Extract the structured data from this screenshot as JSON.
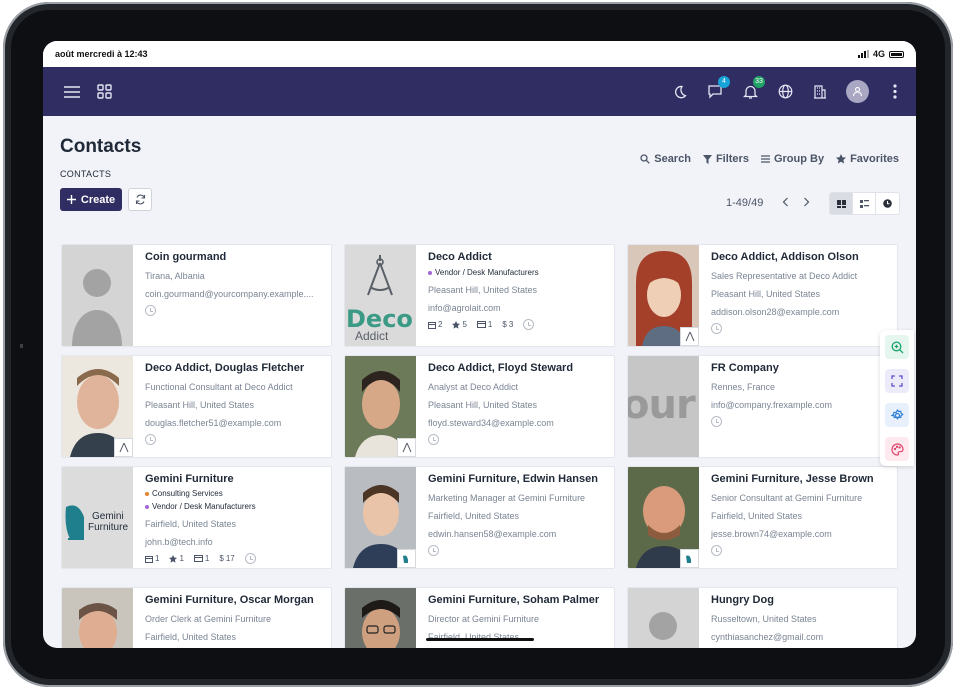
{
  "status_bar": {
    "datetime": "août mercredi à 12:43",
    "network": "4G"
  },
  "navbar": {
    "chat_badge": "4",
    "bell_badge": "33"
  },
  "page": {
    "title": "Contacts",
    "breadcrumb": "CONTACTS",
    "create_label": "Create"
  },
  "search_tools": [
    {
      "label": "Search",
      "icon": "search-icon"
    },
    {
      "label": "Filters",
      "icon": "filter-icon"
    },
    {
      "label": "Group By",
      "icon": "list-icon"
    },
    {
      "label": "Favorites",
      "icon": "star-icon"
    }
  ],
  "pager": {
    "range": "1-49/49"
  },
  "colors": {
    "navbar": "#2f2d62",
    "accent": "#2f2d62",
    "tag_orange": "#e0872e",
    "tag_purple": "#a366d6",
    "background": "#f2f3f8"
  },
  "cards": [
    {
      "name": "Coin gourmand",
      "lines": [
        "Tirana, Albania",
        "coin.gourmand@yourcompany.example...."
      ],
      "tags": [],
      "stats": null,
      "photo": "placeholder"
    },
    {
      "name": "Deco Addict",
      "tags": [
        {
          "label": "Vendor / Desk Manufacturers",
          "color": "purple"
        }
      ],
      "lines": [
        "Pleasant Hill, United States",
        "info@agrolait.com"
      ],
      "stats": {
        "meetings": "2",
        "rating": "5",
        "invoices": "1",
        "sales": "3"
      },
      "photo": "deco-logo"
    },
    {
      "name": "Deco Addict, Addison Olson",
      "lines": [
        "Sales Representative at Deco Addict",
        "Pleasant Hill, United States",
        "addison.olson28@example.com"
      ],
      "tags": [],
      "stats": null,
      "photo": "woman"
    },
    {
      "name": "Deco Addict, Douglas Fletcher",
      "lines": [
        "Functional Consultant at Deco Addict",
        "Pleasant Hill, United States",
        "douglas.fletcher51@example.com"
      ],
      "tags": [],
      "stats": null,
      "photo": "man1"
    },
    {
      "name": "Deco Addict, Floyd Steward",
      "lines": [
        "Analyst at Deco Addict",
        "Pleasant Hill, United States",
        "floyd.steward34@example.com"
      ],
      "tags": [],
      "stats": null,
      "photo": "man2"
    },
    {
      "name": "FR Company",
      "lines": [
        "Rennes, France",
        "info@company.frexample.com"
      ],
      "tags": [],
      "stats": null,
      "photo": "our-logo"
    },
    {
      "name": "Gemini Furniture",
      "tags": [
        {
          "label": "Consulting Services",
          "color": "orange"
        },
        {
          "label": "Vendor / Desk Manufacturers",
          "color": "purple"
        }
      ],
      "lines": [
        "Fairfield, United States",
        "john.b@tech.info"
      ],
      "stats": {
        "meetings": "1",
        "rating": "1",
        "invoices": "1",
        "sales": "17"
      },
      "photo": "gemini-logo"
    },
    {
      "name": "Gemini Furniture, Edwin Hansen",
      "lines": [
        "Marketing Manager at Gemini Furniture",
        "Fairfield, United States",
        "edwin.hansen58@example.com"
      ],
      "tags": [],
      "stats": null,
      "photo": "man3"
    },
    {
      "name": "Gemini Furniture, Jesse Brown",
      "lines": [
        "Senior Consultant at Gemini Furniture",
        "Fairfield, United States",
        "jesse.brown74@example.com"
      ],
      "tags": [],
      "stats": null,
      "photo": "man4"
    },
    {
      "name": "Gemini Furniture, Oscar Morgan",
      "lines": [
        "Order Clerk at Gemini Furniture",
        "Fairfield, United States"
      ],
      "tags": [],
      "stats": null,
      "photo": "man5"
    },
    {
      "name": "Gemini Furniture, Soham Palmer",
      "lines": [
        "Director at Gemini Furniture",
        "Fairfield, United States"
      ],
      "tags": [],
      "stats": null,
      "photo": "man6"
    },
    {
      "name": "Hungry Dog",
      "lines": [
        "Russeltown, United States",
        "cynthiasanchez@gmail.com"
      ],
      "tags": [],
      "stats": null,
      "photo": "placeholder"
    }
  ],
  "logos": {
    "deco_word": "Deco",
    "deco_sub": "Addict",
    "our_word": "our",
    "gemini_1": "Gemini",
    "gemini_2": "Furniture"
  }
}
